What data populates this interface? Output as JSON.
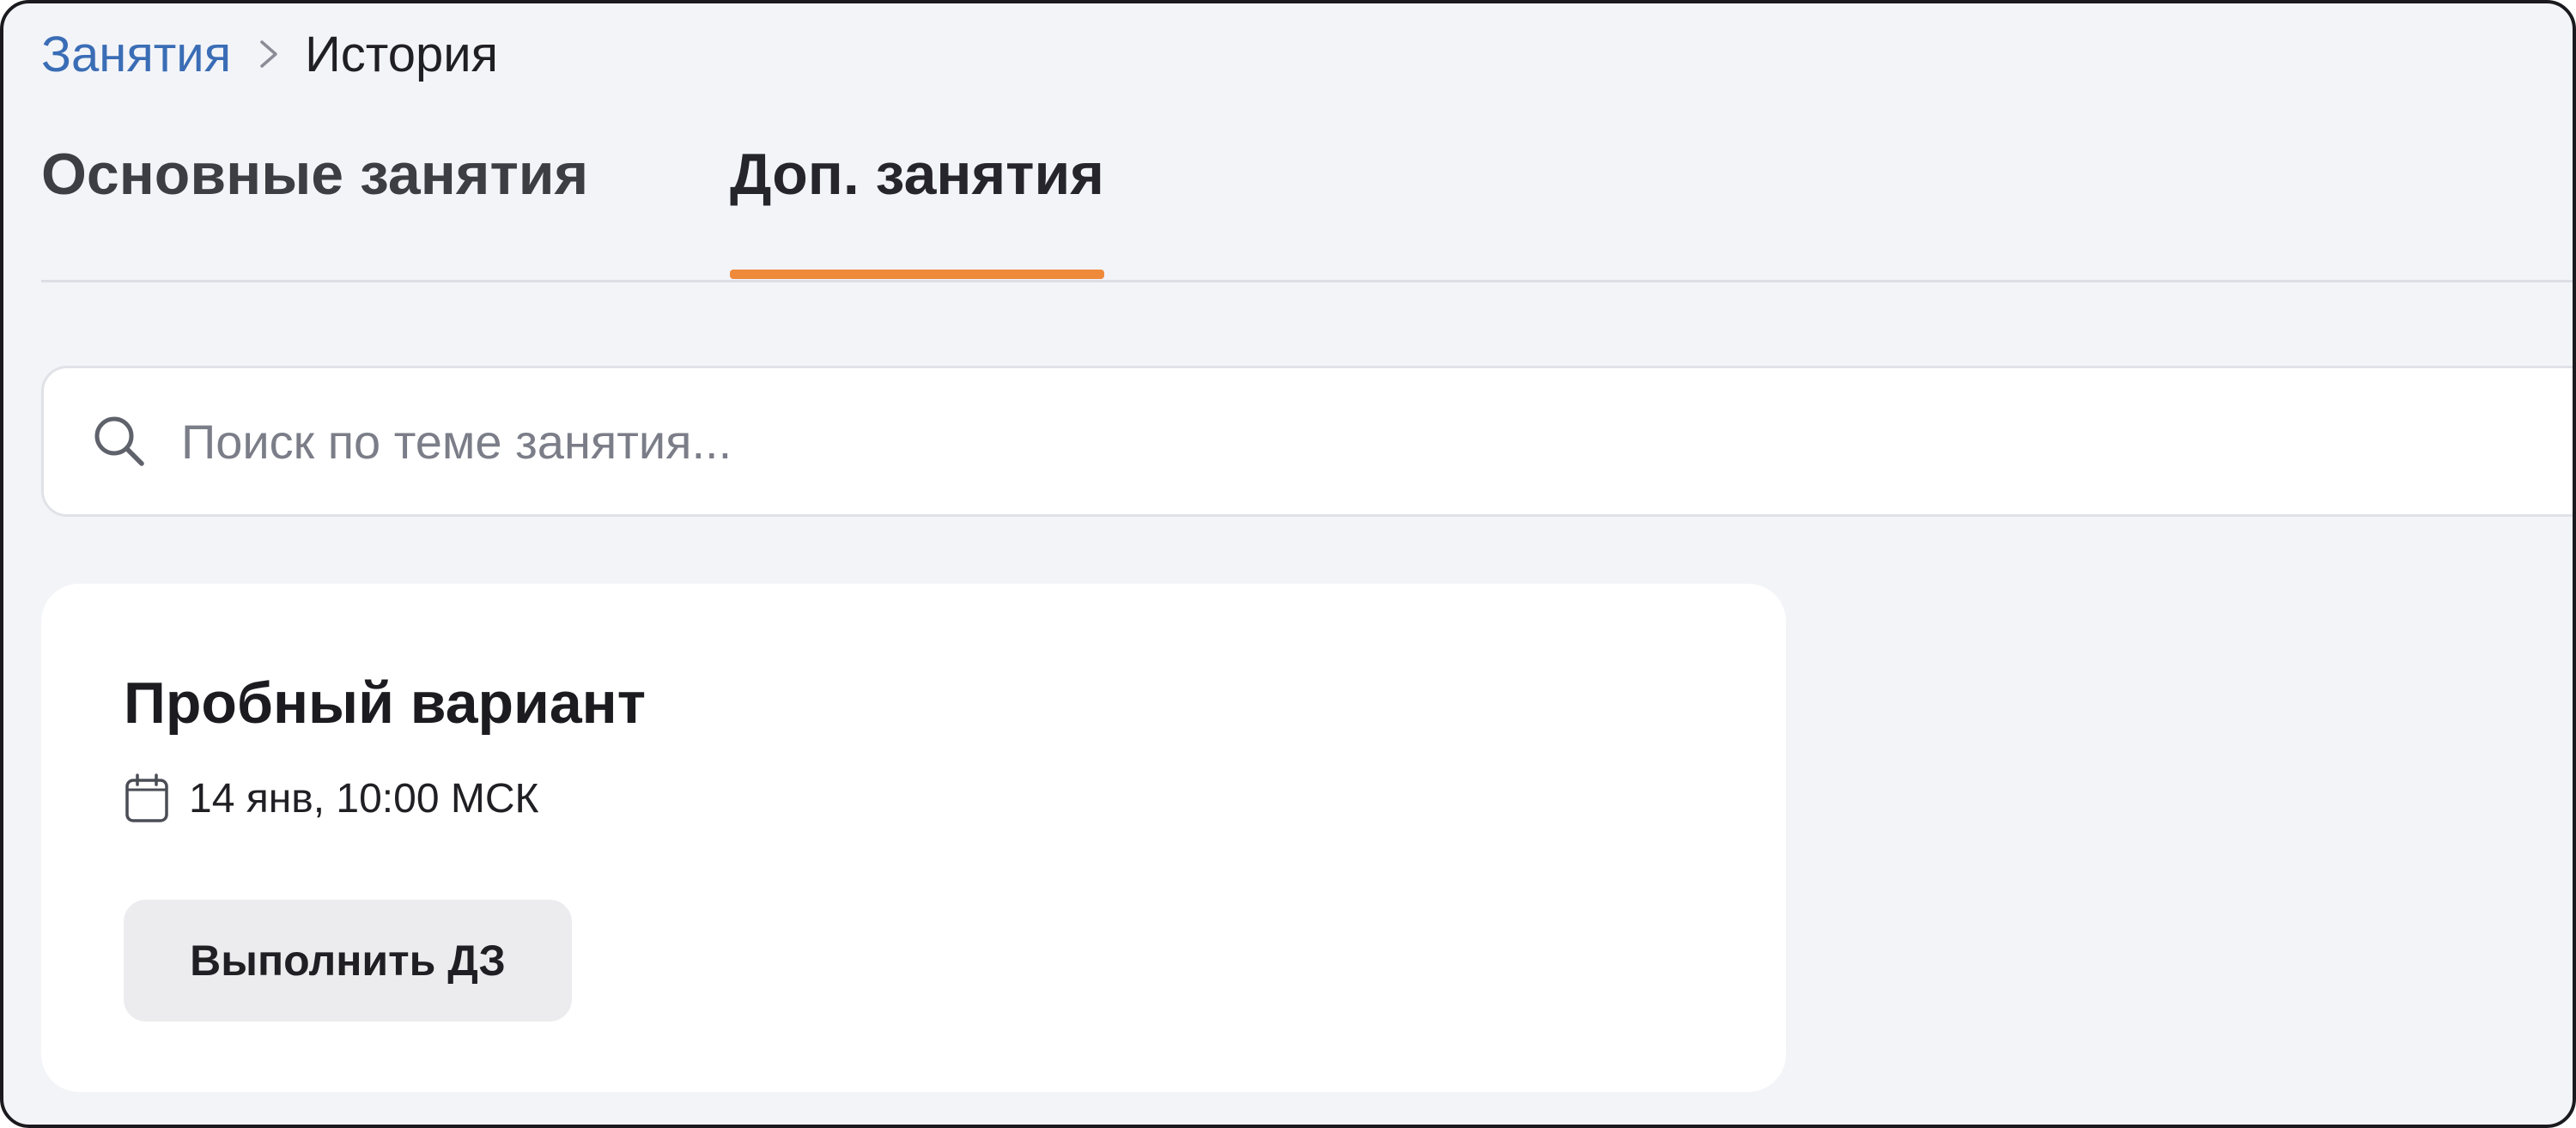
{
  "breadcrumb": {
    "parent": "Занятия",
    "current": "История"
  },
  "tabs": [
    {
      "label": "Основные занятия",
      "active": false
    },
    {
      "label": "Доп. занятия",
      "active": true
    }
  ],
  "search": {
    "placeholder": "Поиск по теме занятия...",
    "value": ""
  },
  "card": {
    "title": "Пробный вариант",
    "date": "14 янв, 10:00 МСК",
    "button_label": "Выполнить ДЗ"
  },
  "colors": {
    "accent": "#ef8a3a",
    "link": "#3a6db5",
    "background": "#f3f4f8"
  },
  "icons": {
    "breadcrumb_separator": "chevron-right-icon",
    "search": "search-icon",
    "date": "calendar-icon"
  }
}
